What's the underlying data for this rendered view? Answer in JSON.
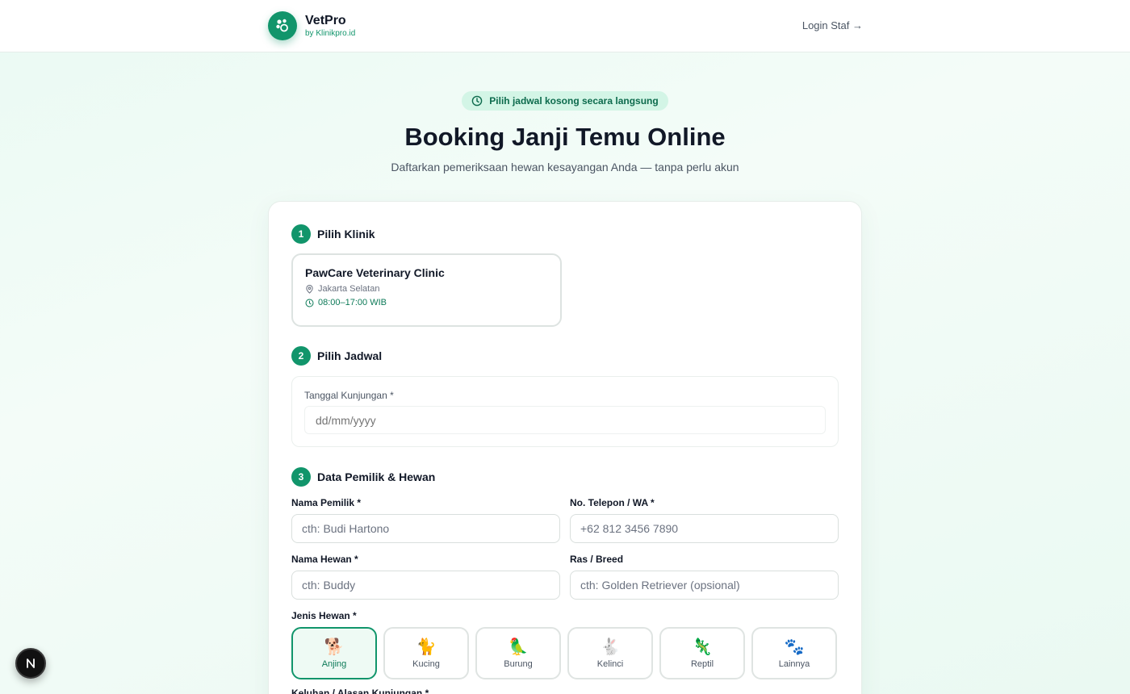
{
  "header": {
    "brand_name": "VetPro",
    "brand_sub": "by Klinikpro.id",
    "login_label": "Login Staf →"
  },
  "hero": {
    "badge": "Pilih jadwal kosong secara langsung",
    "title": "Booking Janji Temu Online",
    "subtitle": "Daftarkan pemeriksaan hewan kesayangan Anda — tanpa perlu akun"
  },
  "steps": [
    {
      "number": "1",
      "title": "Pilih Klinik"
    },
    {
      "number": "2",
      "title": "Pilih Jadwal"
    },
    {
      "number": "3",
      "title": "Data Pemilik & Hewan"
    }
  ],
  "clinic": {
    "name": "PawCare Veterinary Clinic",
    "location": "Jakarta Selatan",
    "hours": "08:00–17:00 WIB"
  },
  "schedule": {
    "date_label": "Tanggal Kunjungan *",
    "date_placeholder": "dd/mm/yyyy"
  },
  "form": {
    "owner_label": "Nama Pemilik *",
    "owner_placeholder": "cth: Budi Hartono",
    "phone_label": "No. Telepon / WA *",
    "phone_placeholder": "+62 812 3456 7890",
    "pet_label": "Nama Hewan *",
    "pet_placeholder": "cth: Buddy",
    "breed_label": "Ras / Breed",
    "breed_placeholder": "cth: Golden Retriever (opsional)",
    "species_label": "Jenis Hewan *",
    "reason_label": "Keluhan / Alasan Kunjungan *"
  },
  "species": [
    {
      "emoji": "🐕",
      "label": "Anjing",
      "selected": true
    },
    {
      "emoji": "🐈",
      "label": "Kucing",
      "selected": false
    },
    {
      "emoji": "🦜",
      "label": "Burung",
      "selected": false
    },
    {
      "emoji": "🐇",
      "label": "Kelinci",
      "selected": false
    },
    {
      "emoji": "🦎",
      "label": "Reptil",
      "selected": false
    },
    {
      "emoji": "🐾",
      "label": "Lainnya",
      "selected": false
    }
  ],
  "dev_badge": "N",
  "colors": {
    "accent": "#11956b",
    "accent_light": "#d3f5e6",
    "text": "#111827",
    "muted": "#4b5563"
  }
}
